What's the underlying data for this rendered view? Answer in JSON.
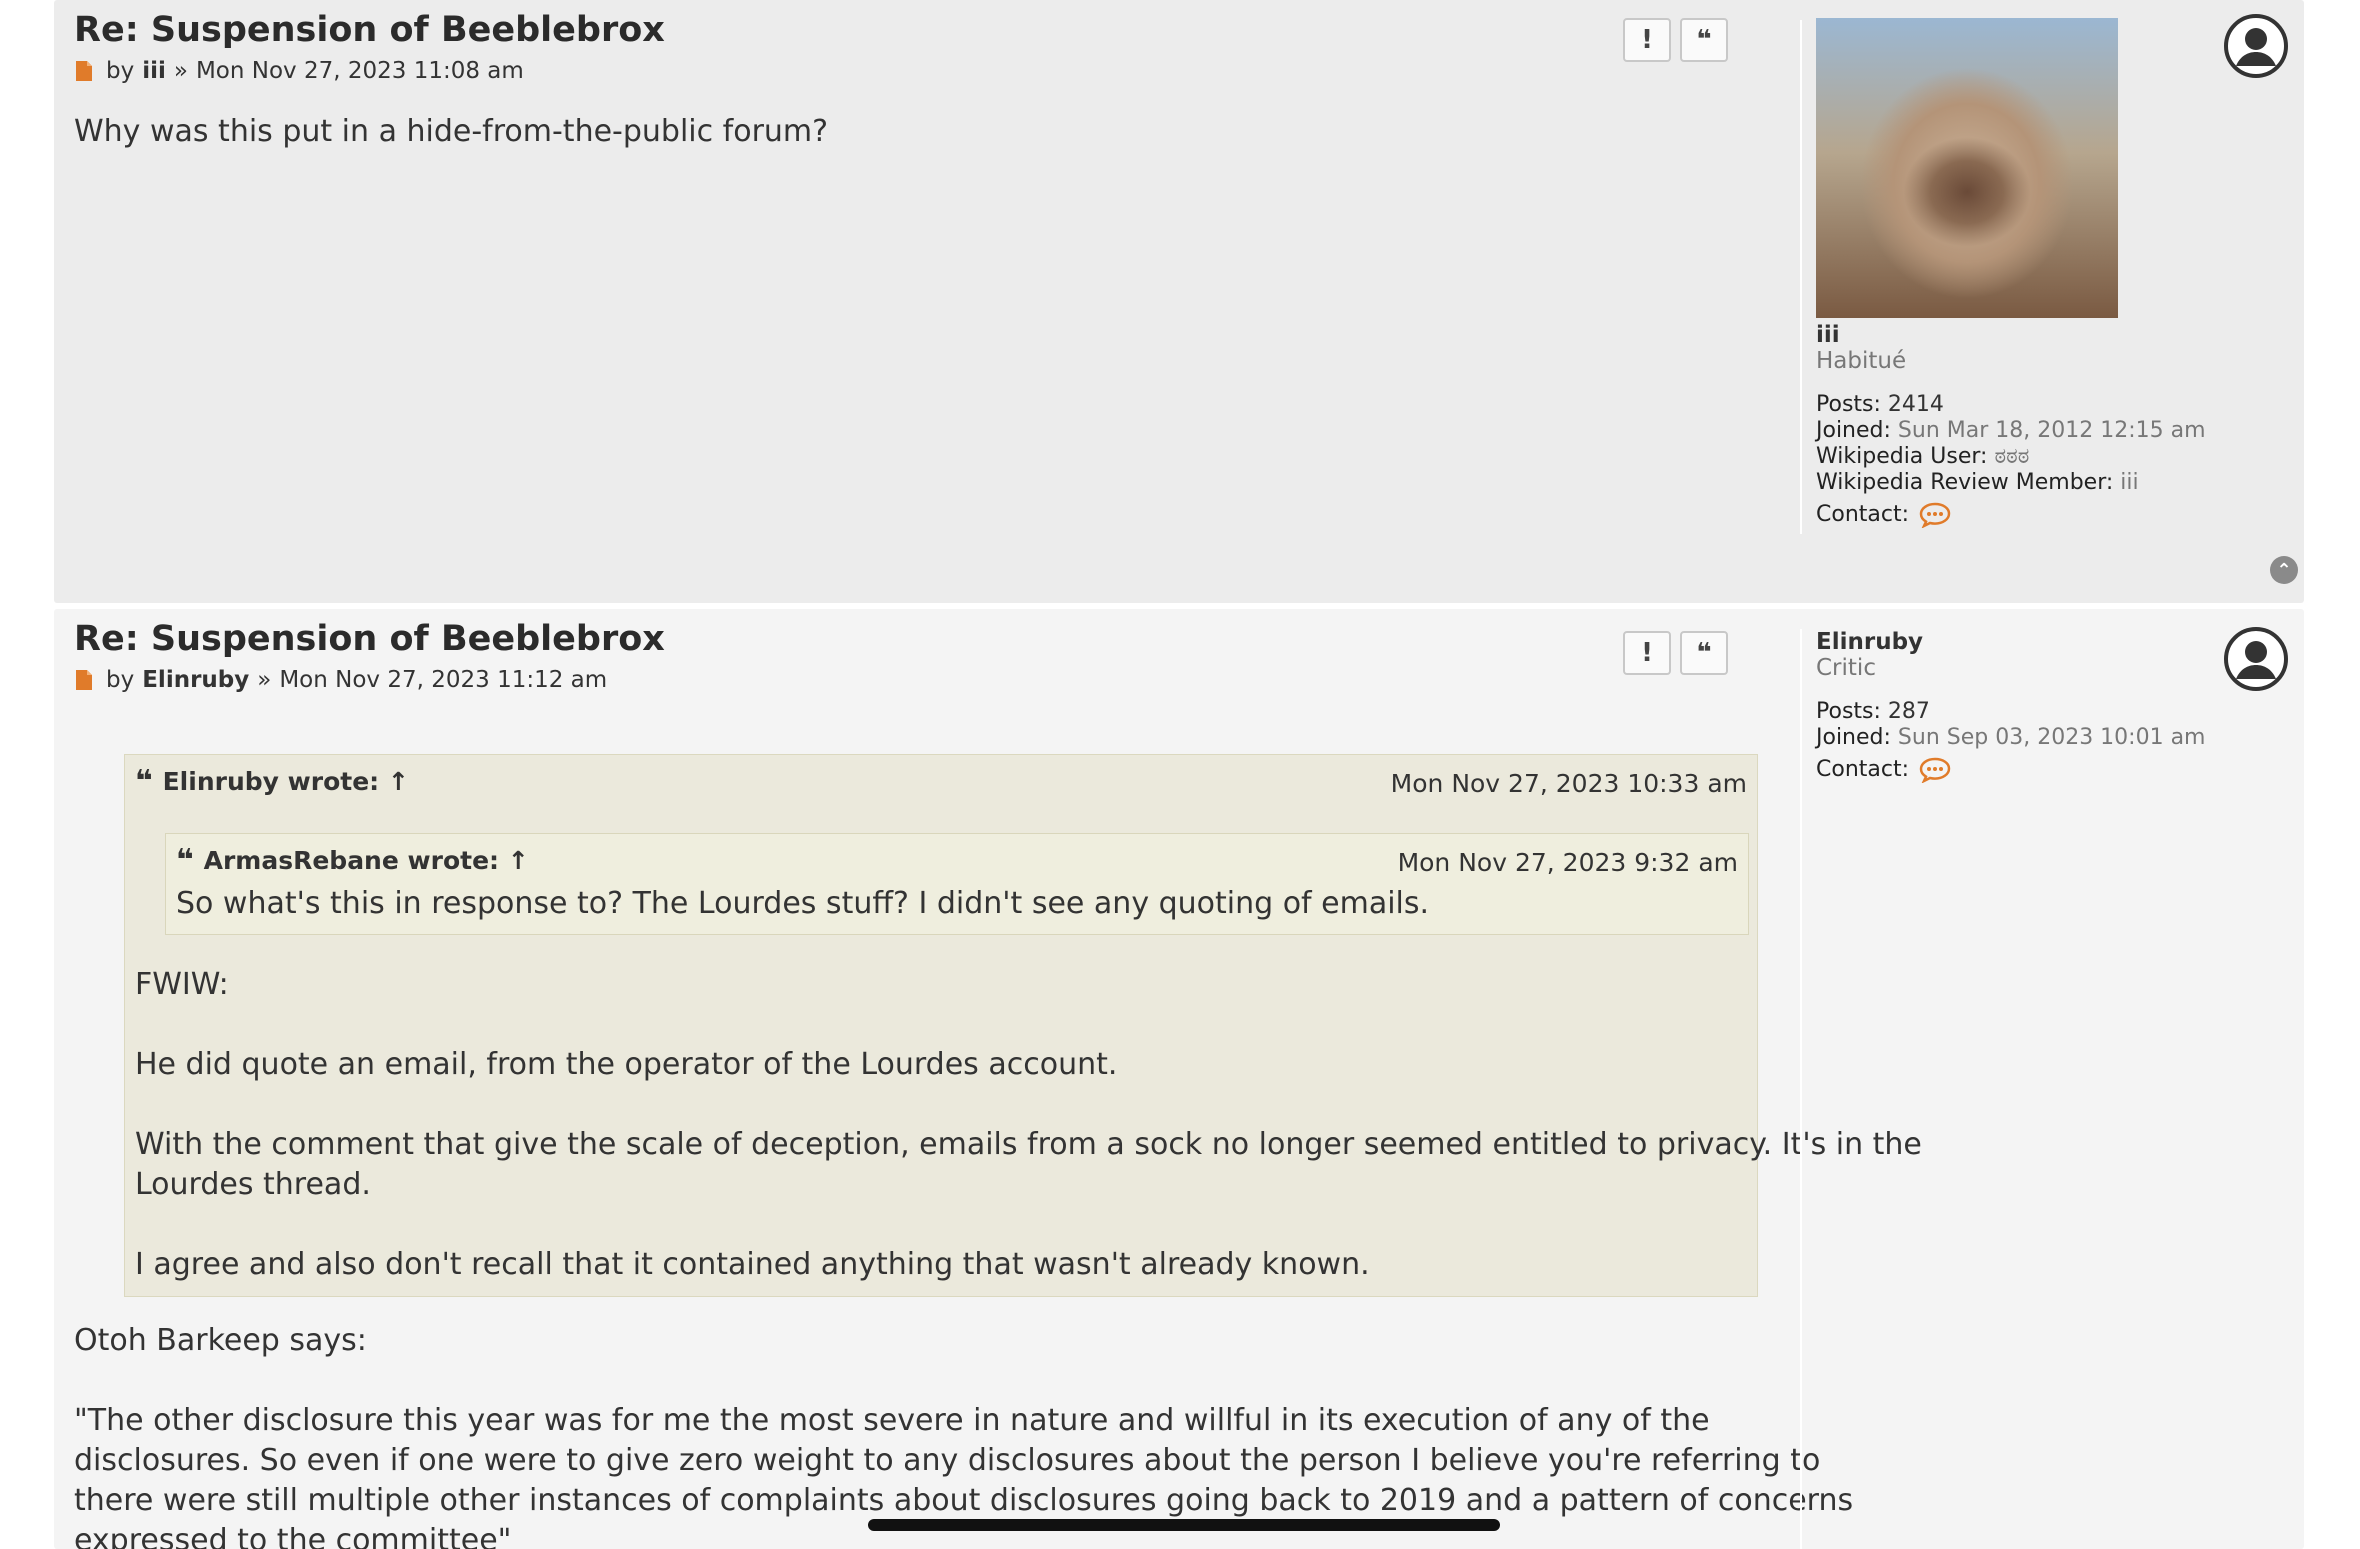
{
  "posts": [
    {
      "title": "Re: Suspension of Beeblebrox",
      "by_label": "by",
      "author": "iii",
      "date_sep": "»",
      "date": "Mon Nov 27, 2023 11:08 am",
      "body": "Why was this put in a hide-from-the-public forum?",
      "report_label": "!",
      "quote_label": "❝",
      "profile": {
        "username": "iii",
        "rank": "Habitué",
        "posts_label": "Posts:",
        "posts": "2414",
        "joined_label": "Joined:",
        "joined": "Sun Mar 18, 2012 12:15 am",
        "wp_user_label": "Wikipedia User:",
        "wp_user": "ಠಠಠ",
        "wr_member_label": "Wikipedia Review Member:",
        "wr_member": "iii",
        "contact_label": "Contact:"
      }
    },
    {
      "title": "Re: Suspension of Beeblebrox",
      "by_label": "by",
      "author": "Elinruby",
      "date_sep": "»",
      "date": "Mon Nov 27, 2023 11:12 am",
      "report_label": "!",
      "quote_label": "❝",
      "outer_quote": {
        "author_line": "Elinruby wrote: ↑",
        "time": "Mon Nov 27, 2023 10:33 am",
        "inner_quote": {
          "author_line": "ArmasRebane wrote: ↑",
          "time": "Mon Nov 27, 2023 9:32 am",
          "text": "So what's this in response to? The Lourdes stuff? I didn't see any quoting of emails."
        },
        "p1": "FWIW:",
        "p2": "He did quote an email, from the operator of the Lourdes account.",
        "p3a": "With the comment that give the scale of deception, emails from a sock no longer seemed entitled to privacy. It's in the",
        "p3b": "Lourdes thread.",
        "p4": "I agree and also don't recall that it contained anything that wasn't already known."
      },
      "body_p1": "Otoh Barkeep says:",
      "body_p2a": "\"The other disclosure this year was for me the most severe in nature and willful in its execution of any of the",
      "body_p2b": "disclosures. So even if one were to give zero weight to any disclosures about the person I believe you're referring to",
      "body_p2c": "there were still multiple other instances of complaints about disclosures going back to 2019 and a pattern of concerns",
      "body_p2d": "expressed to the committee\"",
      "profile": {
        "username": "Elinruby",
        "rank": "Critic",
        "posts_label": "Posts:",
        "posts": "287",
        "joined_label": "Joined:",
        "joined": "Sun Sep 03, 2023 10:01 am",
        "contact_label": "Contact:"
      }
    }
  ],
  "colors": {
    "post_bg_1": "#ececec",
    "post_bg_2": "#f4f4f4",
    "quote_bg": "#ebe9dc",
    "accent_orange": "#d2691e"
  },
  "icons": [
    "post-document-icon",
    "report-icon",
    "quote-icon",
    "user-avatar-icon",
    "contact-chat-icon",
    "back-to-top-icon"
  ]
}
